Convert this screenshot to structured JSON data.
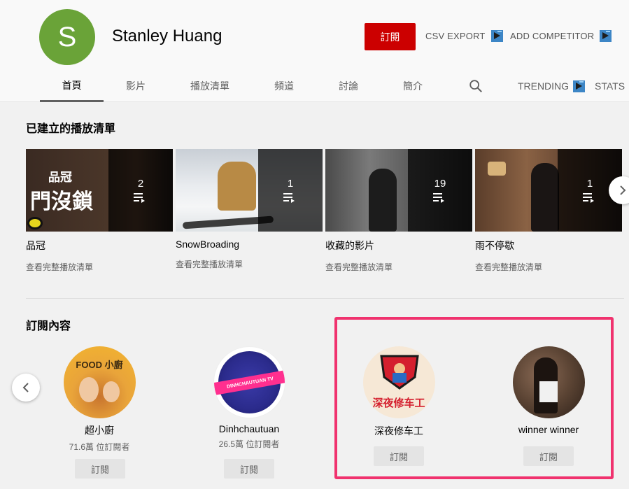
{
  "channel": {
    "avatar_letter": "S",
    "name": "Stanley Huang",
    "subscribe_label": "訂閱",
    "csv_export_label": "CSV EXPORT",
    "add_competitor_label": "ADD COMPETITOR"
  },
  "tabs": [
    "首頁",
    "影片",
    "播放清單",
    "頻道",
    "討論",
    "簡介"
  ],
  "extra_tabs": {
    "trending": "TRENDING",
    "stats": "STATS"
  },
  "playlists": {
    "title": "已建立的播放清單",
    "items": [
      {
        "name": "品冠",
        "count": "2",
        "link": "查看完整播放清單",
        "thumb_text_1": "品冠",
        "thumb_text_2": "門沒鎖"
      },
      {
        "name": "SnowBroading",
        "count": "1",
        "link": "查看完整播放清單"
      },
      {
        "name": "收藏的影片",
        "count": "19",
        "link": "查看完整播放清單"
      },
      {
        "name": "雨不停歇",
        "count": "1",
        "link": "查看完整播放清單"
      }
    ]
  },
  "subscriptions": {
    "title": "訂閱內容",
    "items": [
      {
        "name": "超小廚",
        "subs": "71.6萬 位訂閱者",
        "button": "訂閱",
        "avatar_text": "FOOD 小廚"
      },
      {
        "name": "Dinhchautuan",
        "subs": "26.5萬 位訂閱者",
        "button": "訂閱",
        "avatar_text": "DINHCHAUTUAN TV"
      },
      {
        "name": "深夜修车工",
        "subs": "",
        "button": "訂閱",
        "avatar_text": "深夜修车工"
      },
      {
        "name": "winner winner",
        "subs": "",
        "button": "訂閱"
      }
    ]
  },
  "colors": {
    "subscribe": "#cc0000",
    "highlight": "#f0326e",
    "avatar": "#6aa338"
  }
}
